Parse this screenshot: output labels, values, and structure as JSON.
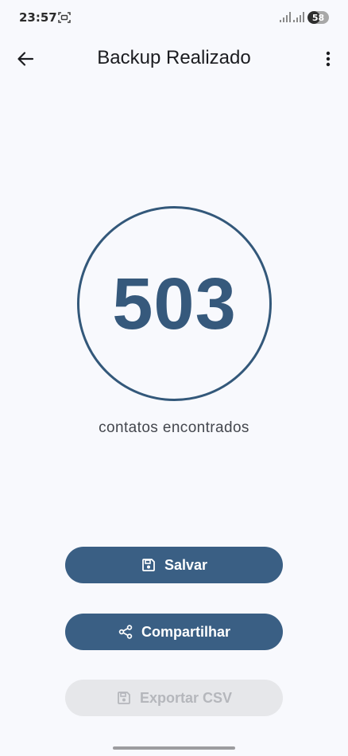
{
  "status_bar": {
    "time": "23:57",
    "battery_level": "58",
    "battery_fill_fraction": 0.58,
    "icons": [
      "screenshot-icon",
      "signal-icon",
      "signal-icon",
      "battery-icon"
    ]
  },
  "app_bar": {
    "title": "Backup Realizado",
    "back_icon": "arrow-left-icon",
    "menu_icon": "more-vertical-icon"
  },
  "result": {
    "count": "503",
    "label": "contatos encontrados"
  },
  "actions": {
    "save": {
      "label": "Salvar",
      "icon": "save-icon",
      "enabled": true
    },
    "share": {
      "label": "Compartilhar",
      "icon": "share-icon",
      "enabled": true
    },
    "export": {
      "label": "Exportar CSV",
      "icon": "save-icon",
      "enabled": false
    }
  },
  "colors": {
    "background": "#f8f9fd",
    "primary": "#3a5f84",
    "counter": "#36597c",
    "disabled_bg": "#e6e7ea",
    "disabled_text": "#b5b7bc"
  }
}
